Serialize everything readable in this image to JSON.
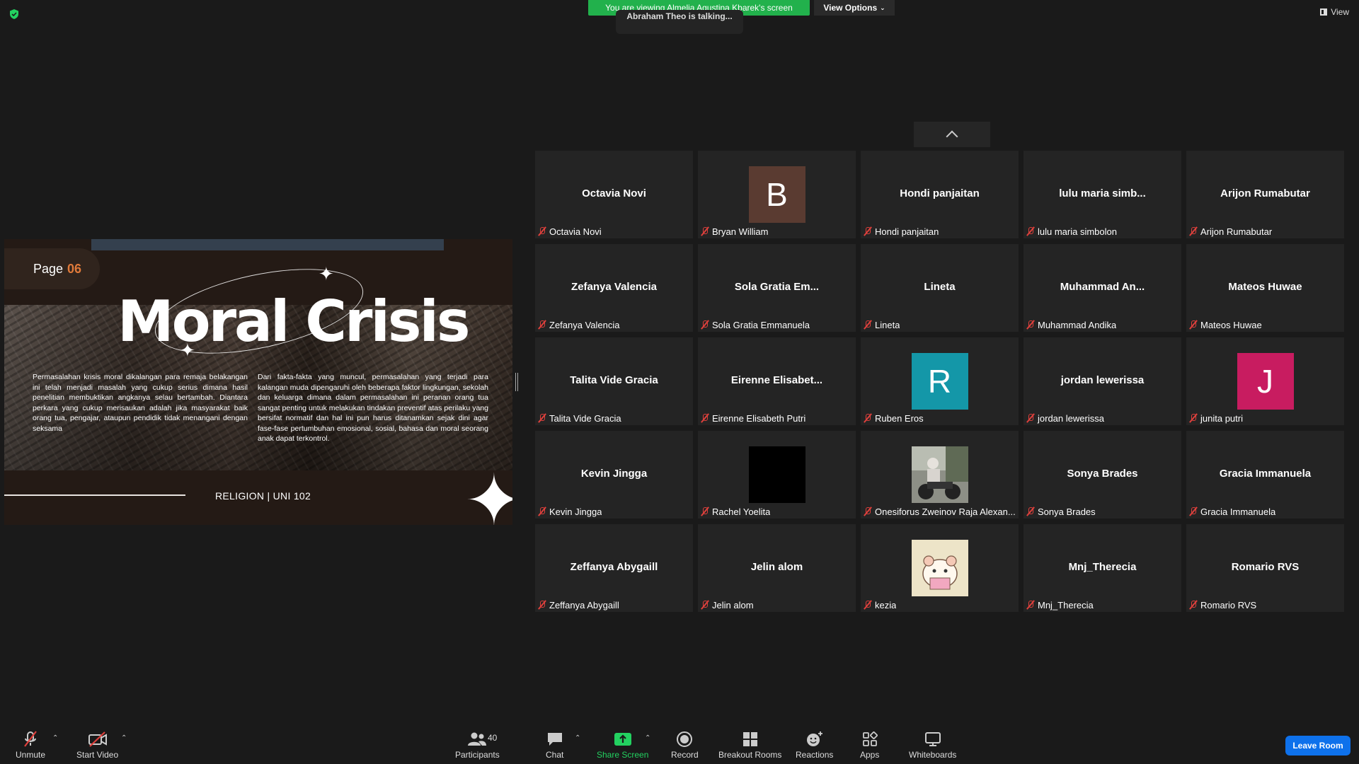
{
  "top": {
    "banner": "You are viewing Almelia Agustina Kbarek's screen",
    "view_options": "View Options",
    "talking": "Abraham Theo is talking...",
    "view": "View"
  },
  "slide": {
    "page_label": "Page",
    "page_number": "06",
    "title": "Moral Crisis",
    "paragraph_1": "Permasalahan krisis moral dikalangan para remaja belakangan ini telah menjadi masalah yang cukup serius dimana hasil penelitian membuktikan angkanya selau bertambah. Diantara perkara yang cukup merisaukan adalah jika masyarakat baik orang tua, pengajar, ataupun pendidik tidak menangani dengan seksama",
    "paragraph_2": "Dari fakta-fakta yang muncul, permasalahan yang terjadi para kalangan muda dipengaruhi oleh beberapa faktor lingkungan, sekolah dan keluarga dimana dalam permasalahan ini peranan orang tua sangat penting untuk melakukan tindakan preventif atas perilaku yang bersifat normatif dan hal ini pun harus ditanamkan sejak dini agar fase-fase pertumbuhan emosional, sosial, bahasa dan moral seorang anak dapat terkontrol.",
    "footer": "RELIGION | UNI 102"
  },
  "gallery": {
    "tiles": [
      {
        "center": "Octavia Novi",
        "name": "Octavia Novi"
      },
      {
        "avatar": "B",
        "avatar_color": "#5a3b31",
        "name": "Bryan William"
      },
      {
        "center": "Hondi panjaitan",
        "name": "Hondi panjaitan"
      },
      {
        "center": "lulu maria simb...",
        "name": "lulu maria simbolon"
      },
      {
        "center": "Arijon Rumabutar",
        "name": "Arijon Rumabutar"
      },
      {
        "center": "Zefanya Valencia",
        "name": "Zefanya Valencia"
      },
      {
        "center": "Sola Gratia Em...",
        "name": "Sola Gratia Emmanuela"
      },
      {
        "center": "Lineta",
        "name": "Lineta"
      },
      {
        "center": "Muhammad An...",
        "name": "Muhammad Andika"
      },
      {
        "center": "Mateos Huwae",
        "name": "Mateos Huwae"
      },
      {
        "center": "Talita Vide Gracia",
        "name": "Talita Vide Gracia"
      },
      {
        "center": "Eirenne Elisabet...",
        "name": "Eirenne Elisabeth Putri"
      },
      {
        "avatar": "R",
        "avatar_color": "#1497a8",
        "name": "Ruben Eros"
      },
      {
        "center": "jordan lewerissa",
        "name": "jordan lewerissa"
      },
      {
        "avatar": "J",
        "avatar_color": "#c81c60",
        "name": "junita putri"
      },
      {
        "center": "Kevin Jingga",
        "name": "Kevin Jingga"
      },
      {
        "avatar": "",
        "avatar_color": "#000000",
        "name": "Rachel Yoelita"
      },
      {
        "photo": "motorbike",
        "name": "Onesiforus Zweinov Raja Alexan..."
      },
      {
        "center": "Sonya Brades",
        "name": "Sonya Brades"
      },
      {
        "center": "Gracia Immanuela",
        "name": "Gracia Immanuela"
      },
      {
        "center": "Zeffanya Abygaill",
        "name": "Zeffanya Abygaill"
      },
      {
        "center": "Jelin alom",
        "name": "Jelin alom"
      },
      {
        "photo": "hamster",
        "name": "kezia"
      },
      {
        "center": "Mnj_Therecia",
        "name": "Mnj_Therecia"
      },
      {
        "center": "Romario RVS",
        "name": "Romario RVS"
      }
    ]
  },
  "toolbar": {
    "unmute": "Unmute",
    "start_video": "Start Video",
    "participants": "Participants",
    "participants_count": "40",
    "chat": "Chat",
    "share_screen": "Share Screen",
    "record": "Record",
    "breakout_rooms": "Breakout Rooms",
    "reactions": "Reactions",
    "apps": "Apps",
    "whiteboards": "Whiteboards",
    "leave_room": "Leave Room"
  }
}
